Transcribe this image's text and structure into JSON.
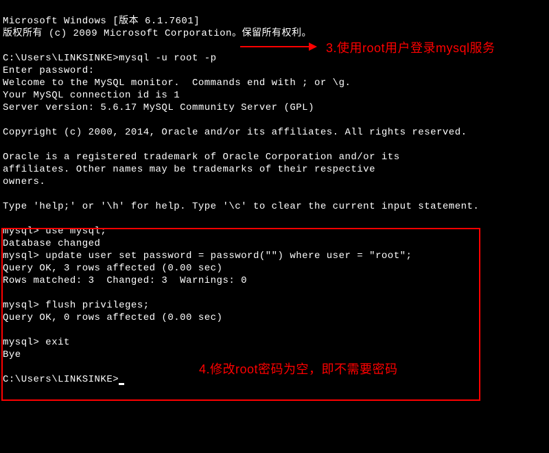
{
  "terminal": {
    "line1": "Microsoft Windows [版本 6.1.7601]",
    "line2": "版权所有 (c) 2009 Microsoft Corporation。保留所有权利。",
    "blank1": "",
    "line3": "C:\\Users\\LINKSINKE>mysql -u root -p",
    "line4": "Enter password:",
    "line5": "Welcome to the MySQL monitor.  Commands end with ; or \\g.",
    "line6": "Your MySQL connection id is 1",
    "line7": "Server version: 5.6.17 MySQL Community Server (GPL)",
    "blank2": "",
    "line8": "Copyright (c) 2000, 2014, Oracle and/or its affiliates. All rights reserved.",
    "blank3": "",
    "line9": "Oracle is a registered trademark of Oracle Corporation and/or its",
    "line10": "affiliates. Other names may be trademarks of their respective",
    "line11": "owners.",
    "blank4": "",
    "line12": "Type 'help;' or '\\h' for help. Type '\\c' to clear the current input statement.",
    "blank5": "",
    "line13": "mysql> use mysql;",
    "line14": "Database changed",
    "line15": "mysql> update user set password = password(\"\") where user = \"root\";",
    "line16": "Query OK, 3 rows affected (0.00 sec)",
    "line17": "Rows matched: 3  Changed: 3  Warnings: 0",
    "blank6": "",
    "line18": "mysql> flush privileges;",
    "line19": "Query OK, 0 rows affected (0.00 sec)",
    "blank7": "",
    "line20": "mysql> exit",
    "line21": "Bye",
    "blank8": "",
    "line22": "C:\\Users\\LINKSINKE>"
  },
  "annotations": {
    "note1": "3.使用root用户登录mysql服务",
    "note2": "4.修改root密码为空，即不需要密码"
  }
}
